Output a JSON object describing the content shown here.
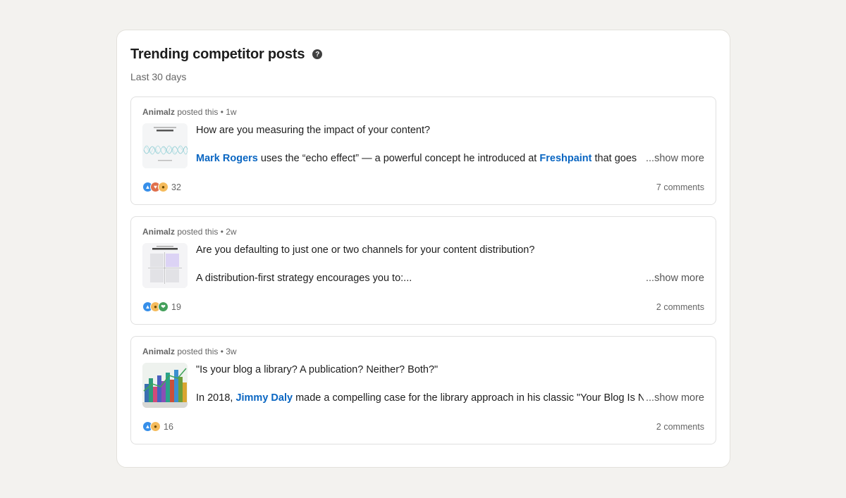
{
  "header": {
    "title": "Trending competitor posts",
    "help_icon": "question-circle-icon",
    "subtitle": "Last 30 days"
  },
  "posts": [
    {
      "author": "Animalz",
      "posted_text": " posted this • 1w",
      "line1": "How are you measuring the impact of your content?",
      "line2_parts": [
        {
          "text": "Mark Rogers",
          "mention": true
        },
        {
          "text": " uses the “echo effect” — a powerful concept he introduced at ",
          "mention": false
        },
        {
          "text": "Freshpaint",
          "mention": true
        },
        {
          "text": " that goes",
          "mention": false
        }
      ],
      "show_more": "...show more",
      "reactions": [
        "like",
        "love",
        "insightful"
      ],
      "reaction_count": "32",
      "comments": "7 comments"
    },
    {
      "author": "Animalz",
      "posted_text": " posted this • 2w",
      "line1": "Are you defaulting to just one or two channels for your content distribution?",
      "line2_parts": [
        {
          "text": "A distribution-first strategy encourages you to:...",
          "mention": false
        }
      ],
      "show_more": "...show more",
      "reactions": [
        "like",
        "insightful",
        "support"
      ],
      "reaction_count": "19",
      "comments": "2 comments"
    },
    {
      "author": "Animalz",
      "posted_text": " posted this • 3w",
      "line1": "\"Is your blog a library? A publication? Neither? Both?\"",
      "line2_parts": [
        {
          "text": "In 2018, ",
          "mention": false
        },
        {
          "text": "Jimmy Daly",
          "mention": true
        },
        {
          "text": " made a compelling case for the library approach in his classic \"Your Blog Is N",
          "mention": false
        }
      ],
      "show_more": "...show more",
      "reactions": [
        "like",
        "insightful"
      ],
      "reaction_count": "16",
      "comments": "2 comments"
    }
  ],
  "colors": {
    "mention": "#0a66c2",
    "background": "#f3f2ef",
    "like": "#378fe9",
    "love": "#df704d",
    "insightful": "#f5bb5c",
    "support": "#44a05b"
  }
}
